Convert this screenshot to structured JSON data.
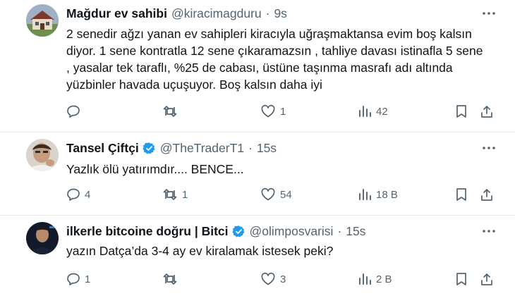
{
  "tweets": [
    {
      "name": "Mağdur ev sahibi",
      "handle": "@kiracimagduru",
      "separator": "·",
      "time": "9s",
      "verified": false,
      "text_lines": [
        "2 senedir ağzı yanan ev sahipleri kiracıyla uğraşmaktansa evim boş kalsın",
        "diyor. 1 sene kontratla 12 sene çıkaramazsın , tahliye davası istinafla 5 sene",
        ", yasalar tek taraflı, %25 de cabası, üstüne taşınma masrafı adı altında",
        "yüzbinler havada uçuşuyor. Boş kalsın daha iyi"
      ],
      "replies": "",
      "retweets": "",
      "likes": "1",
      "views": "42"
    },
    {
      "name": "Tansel Çiftçi",
      "handle": "@TheTraderT1",
      "separator": "·",
      "time": "15s",
      "verified": true,
      "text_lines": [
        "Yazlık ölü yatırımdır.... BENCE..."
      ],
      "replies": "4",
      "retweets": "1",
      "likes": "54",
      "views": "18 B"
    },
    {
      "name": "ilkerle bitcoine doğru | Bitci",
      "handle": "@olimposvarisi",
      "separator": "·",
      "time": "15s",
      "verified": true,
      "text_lines": [
        "yazın Datça’da 3-4 ay ev kiralamak istesek peki?"
      ],
      "replies": "1",
      "retweets": "",
      "likes": "3",
      "views": "2 B"
    }
  ],
  "icons": {
    "reply": "reply-icon",
    "retweet": "retweet-icon",
    "like": "heart-icon",
    "views": "views-icon",
    "bookmark": "bookmark-icon",
    "share": "share-icon",
    "more": "more-icon",
    "verified": "verified-badge-icon"
  },
  "colors": {
    "text": "#0f1419",
    "secondary": "#536471",
    "verified": "#1d9bf0",
    "divider": "#e6ecf0"
  }
}
